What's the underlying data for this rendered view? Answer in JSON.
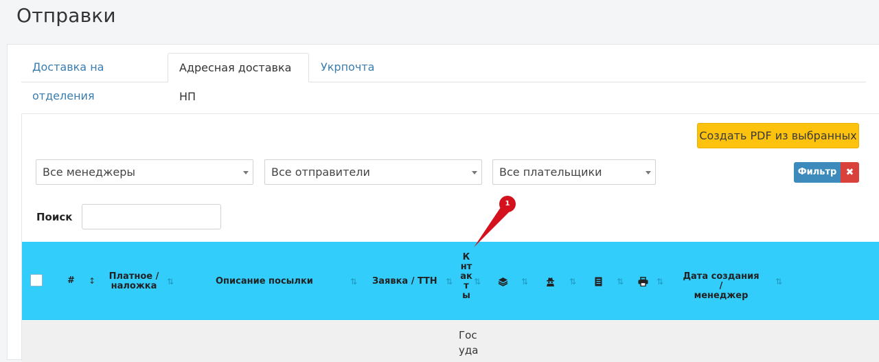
{
  "page": {
    "title": "Отправки",
    "corner_mark": "'"
  },
  "tabs": [
    {
      "label": "Доставка на отделения",
      "active": false
    },
    {
      "label": "Адресная доставка НП",
      "active": true
    },
    {
      "label": "Укрпочта",
      "active": false
    }
  ],
  "toolbar": {
    "pdf_button": "Создать PDF из выбранных"
  },
  "filters": {
    "managers": "Все менеджеры",
    "senders": "Все отправители",
    "payers": "Все плательщики",
    "filter_button": "Фильтр",
    "clear_button": "✖"
  },
  "search": {
    "label": "Поиск",
    "value": ""
  },
  "table": {
    "headers": {
      "number": "#",
      "paid": [
        "Платное /",
        "наложка"
      ],
      "description": "Описание посылки",
      "request": "Заявка / ТТН",
      "contacts": [
        "К",
        "нт",
        "ак",
        "т",
        "ы"
      ],
      "created": [
        "Дата создания /",
        "менеджер"
      ]
    },
    "icons": [
      "layers-icon",
      "user-secret-icon",
      "document-icon",
      "printer-icon"
    ],
    "sort_glyph": "⇅",
    "sort_glyph_active": "↕",
    "first_row": {
      "contacts": [
        "Гос",
        "уда"
      ]
    }
  },
  "annotation": {
    "marker": "1"
  },
  "colors": {
    "header": "#33cdfc",
    "accent": "#fdc20d",
    "filter": "#3d8bbd",
    "danger": "#d9423a",
    "marker": "#d3121d"
  }
}
